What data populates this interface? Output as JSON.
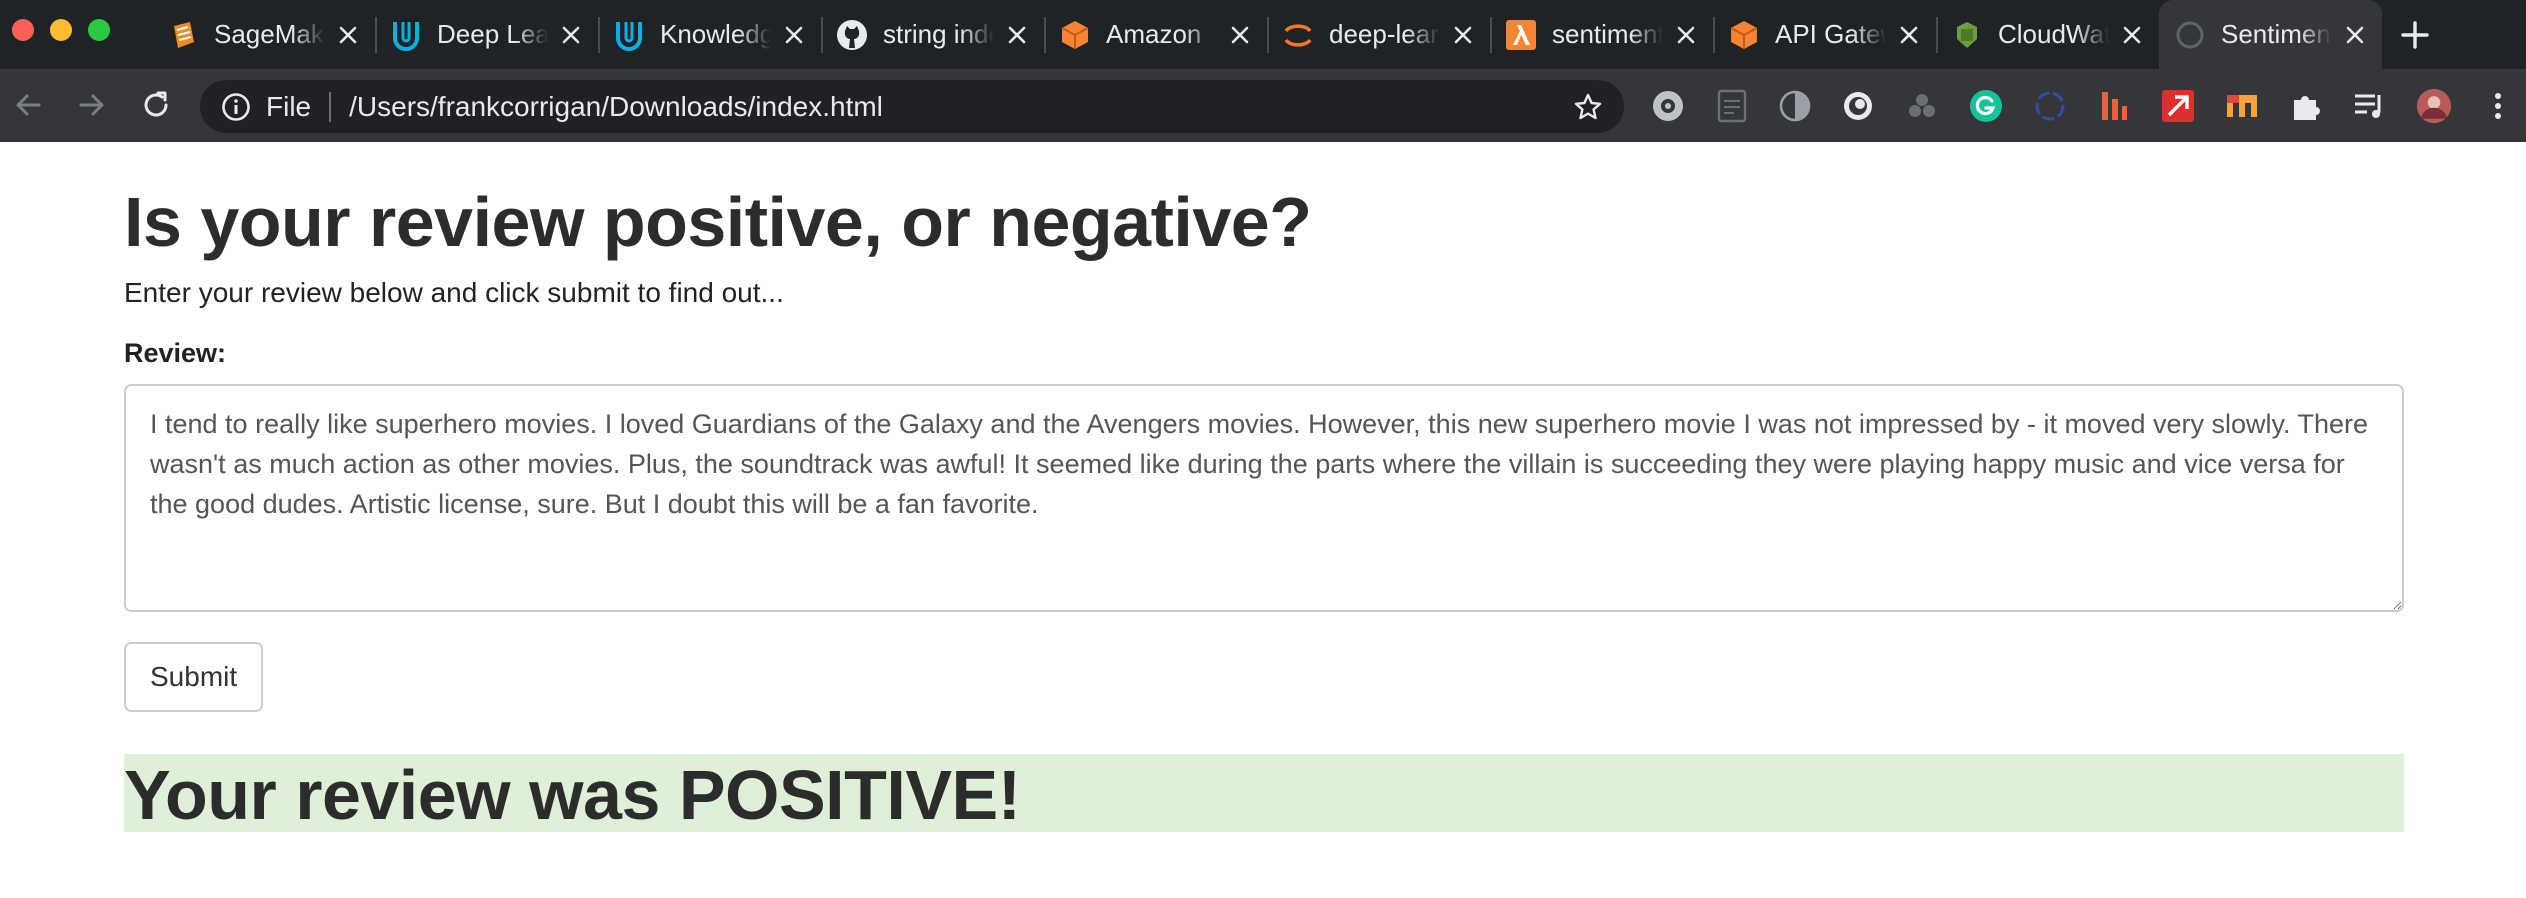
{
  "browser": {
    "tabs": [
      {
        "title": "SageMaker",
        "icon": "sagemaker-icon",
        "active": false
      },
      {
        "title": "Deep Learning",
        "icon": "udacity-icon",
        "active": false
      },
      {
        "title": "Knowledge",
        "icon": "udacity-icon",
        "active": false
      },
      {
        "title": "string index",
        "icon": "github-icon",
        "active": false
      },
      {
        "title": "Amazon",
        "icon": "aws-box-icon",
        "active": false
      },
      {
        "title": "deep-learning",
        "icon": "jupyter-icon",
        "active": false
      },
      {
        "title": "sentiment",
        "icon": "lambda-icon",
        "active": false
      },
      {
        "title": "API Gateway",
        "icon": "aws-box-icon",
        "active": false
      },
      {
        "title": "CloudWatch",
        "icon": "cloudwatch-icon",
        "active": false
      },
      {
        "title": "Sentiment",
        "icon": "globe-icon",
        "active": true
      }
    ],
    "omnibox": {
      "scheme": "File",
      "url": "/Users/frankcorrigan/Downloads/index.html"
    },
    "colors": {
      "tabstrip": "#202326",
      "toolbar": "#35363a",
      "omnibox": "#202124"
    }
  },
  "page": {
    "heading": "Is your review positive, or negative?",
    "subtitle": "Enter your review below and click submit to find out...",
    "review_label": "Review:",
    "review_text": "I tend to really like superhero movies. I loved Guardians of the Galaxy and the Avengers movies. However, this new superhero movie I was not impressed by - it moved very slowly. There wasn't as much action as other movies. Plus, the soundtrack was awful! It seemed like during the parts where the villain is succeeding they were playing happy music and vice versa for the good dudes. Artistic license, sure. But I doubt this will be a fan favorite.",
    "submit_label": "Submit",
    "result": "Your review was POSITIVE!",
    "result_color": "#dff0d8"
  }
}
